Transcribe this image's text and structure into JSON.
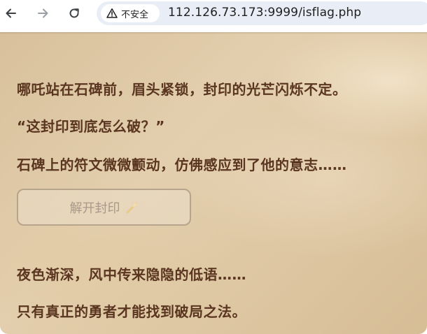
{
  "browser": {
    "security_label": "不安全",
    "url": "112.126.73.173:9999/isflag.php"
  },
  "content": {
    "lines": [
      "哪吒站在石碑前，眉头紧锁，封印的光芒闪烁不定。",
      "“这封印到底怎么破？”",
      "石碑上的符文微微颤动，仿佛感应到了他的意志……",
      "夜色渐深，风中传来隐隐的低语……",
      "只有真正的勇者才能找到破局之法。"
    ],
    "unseal_button": {
      "label": "解开封印",
      "icon": "magic-wand-icon",
      "state": "disabled"
    }
  },
  "colors": {
    "text": "#5a3520",
    "button_text": "#a8998a",
    "button_border": "#b6a48c",
    "background": "#e3cfae"
  }
}
